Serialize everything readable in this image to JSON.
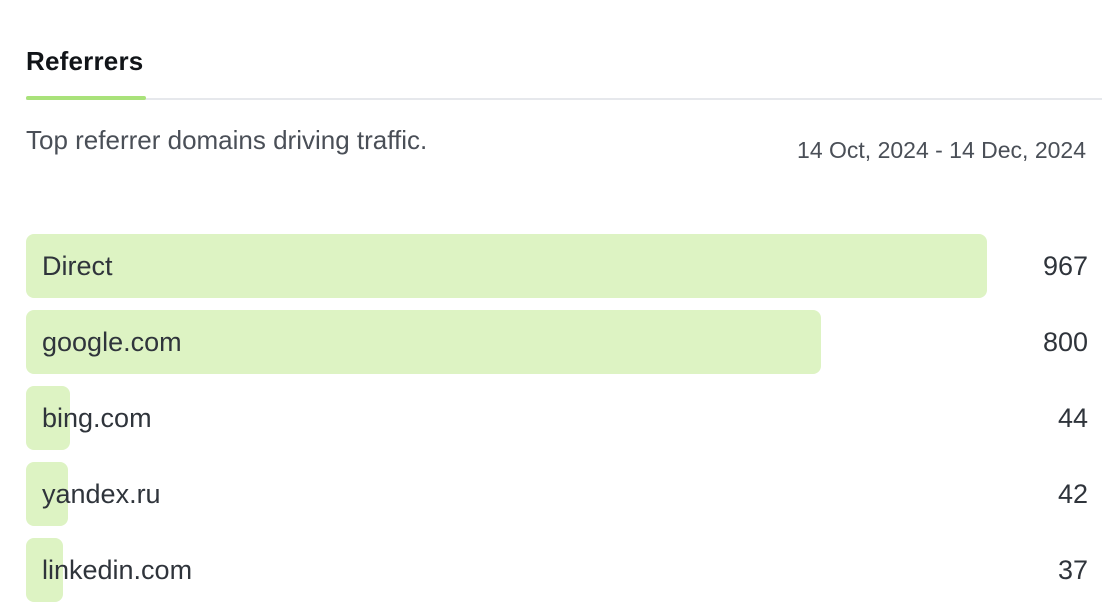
{
  "tabs": [
    {
      "label": "Referrers",
      "active": true
    }
  ],
  "header": {
    "subtitle": "Top referrer domains driving traffic.",
    "date_range": "14 Oct, 2024 - 14 Dec, 2024"
  },
  "colors": {
    "accent": "#a9e27a",
    "bar": "#ddf3c3"
  },
  "referrers": [
    {
      "label": "Direct",
      "value": 967
    },
    {
      "label": "google.com",
      "value": 800
    },
    {
      "label": "bing.com",
      "value": 44
    },
    {
      "label": "yandex.ru",
      "value": 42
    },
    {
      "label": "linkedin.com",
      "value": 37
    }
  ]
}
